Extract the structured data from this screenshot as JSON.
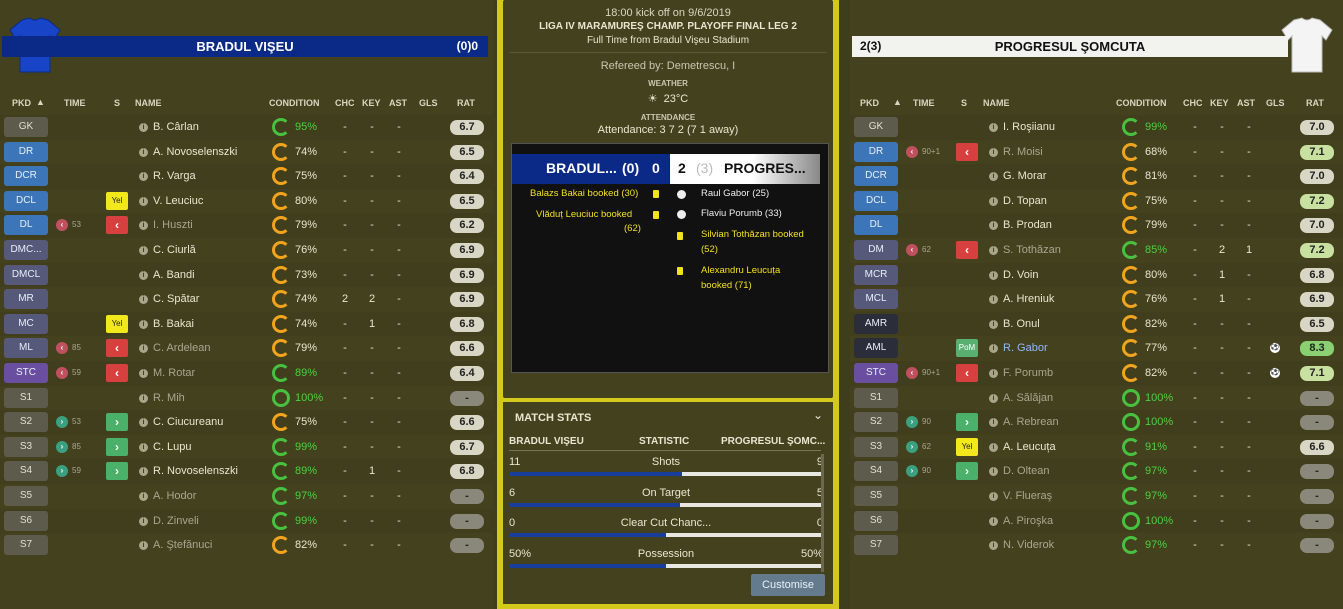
{
  "home": {
    "name": "BRADUL VIŞEU",
    "score": "(0)0",
    "short": "BRADUL...",
    "sb_pen": "(0)",
    "sb_score": "0"
  },
  "away": {
    "name": "PROGRESUL ŞOMCUTA",
    "score": "2(3)",
    "short": "PROGRES...",
    "sb_pen": "(3)",
    "sb_score": "2"
  },
  "headers": {
    "pkd": "PKD",
    "time": "TIME",
    "s": "S",
    "name": "NAME",
    "condition": "CONDITION",
    "chc": "CHC",
    "key": "KEY",
    "ast": "AST",
    "gls": "GLS",
    "rat": "RAT"
  },
  "match": {
    "kickoff": "18:00 kick off on 9/6/2019",
    "competition": "LIGA IV MARAMUREŞ CHAMP. PLAYOFF FINAL LEG 2",
    "result_line": "Full Time from Bradul Vişeu Stadium",
    "referee": "Refereed by: Demetrescu, I",
    "weather_label": "WEATHER",
    "temperature": "23°C",
    "attendance_label": "ATTENDANCE",
    "attendance": "Attendance: 3 7 2 (7 1 away)"
  },
  "events_home": [
    "Balazs Bakai booked (30)",
    "Vlăduț Leuciuc booked",
    "(62)"
  ],
  "events_away": [
    "Raul Gabor (25)",
    "Flaviu Porumb (33)",
    "Silvian Tothăzan booked",
    "(52)",
    "Alexandru Leucuța",
    "booked (71)"
  ],
  "stats": {
    "title": "MATCH STATS",
    "col_home": "BRADUL VIŞEU",
    "col_stat": "STATISTIC",
    "col_away": "PROGRESUL ŞOMC...",
    "rows": [
      {
        "label": "Shots",
        "home": "11",
        "away": "9",
        "home_share": 0.55
      },
      {
        "label": "On Target",
        "home": "6",
        "away": "5",
        "home_share": 0.545
      },
      {
        "label": "Clear Cut Chanc...",
        "home": "0",
        "away": "0",
        "home_share": 0.5
      },
      {
        "label": "Possession",
        "home": "50%",
        "away": "50%",
        "home_share": 0.5
      }
    ],
    "customise": "Customise"
  },
  "home_players": [
    {
      "pos": "GK",
      "name": "B. Cârlan",
      "cond": "95%",
      "chc": "-",
      "key": "-",
      "ast": "-",
      "rat": "6.7"
    },
    {
      "pos": "DR",
      "name": "A. Novoselenszki",
      "cond": "74%",
      "chc": "-",
      "key": "-",
      "ast": "-",
      "rat": "6.5"
    },
    {
      "pos": "DCR",
      "name": "R. Varga",
      "cond": "75%",
      "chc": "-",
      "key": "-",
      "ast": "-",
      "rat": "6.4"
    },
    {
      "pos": "DCL",
      "name": "V. Leuciuc",
      "cond": "80%",
      "chc": "-",
      "key": "-",
      "ast": "-",
      "rat": "6.5",
      "s": "Yel"
    },
    {
      "pos": "DL",
      "name": "I. Huszti",
      "cond": "79%",
      "chc": "-",
      "key": "-",
      "ast": "-",
      "rat": "6.2",
      "time": "53"
    },
    {
      "pos": "DMC...",
      "name": "C. Ciurlă",
      "cond": "76%",
      "chc": "-",
      "key": "-",
      "ast": "-",
      "rat": "6.9"
    },
    {
      "pos": "DMCL",
      "name": "A. Bandi",
      "cond": "73%",
      "chc": "-",
      "key": "-",
      "ast": "-",
      "rat": "6.9"
    },
    {
      "pos": "MR",
      "name": "C. Spătar",
      "cond": "74%",
      "chc": "2",
      "key": "2",
      "ast": "-",
      "rat": "6.9"
    },
    {
      "pos": "MC",
      "name": "B. Bakai",
      "cond": "74%",
      "chc": "-",
      "key": "1",
      "ast": "-",
      "rat": "6.8",
      "s": "Yel"
    },
    {
      "pos": "ML",
      "name": "C. Ardelean",
      "cond": "79%",
      "chc": "-",
      "key": "-",
      "ast": "-",
      "rat": "6.6",
      "time": "85"
    },
    {
      "pos": "STC",
      "name": "M. Rotar",
      "cond": "89%",
      "chc": "-",
      "key": "-",
      "ast": "-",
      "rat": "6.4",
      "time": "59"
    },
    {
      "pos": "S1",
      "name": "R. Mih",
      "cond": "100%",
      "chc": "-",
      "key": "-",
      "ast": "-",
      "rat": "-"
    },
    {
      "pos": "S2",
      "name": "C. Ciucureanu",
      "cond": "75%",
      "chc": "-",
      "key": "-",
      "ast": "-",
      "rat": "6.6",
      "time": "53"
    },
    {
      "pos": "S3",
      "name": "C. Lupu",
      "cond": "99%",
      "chc": "-",
      "key": "-",
      "ast": "-",
      "rat": "6.7",
      "time": "85"
    },
    {
      "pos": "S4",
      "name": "R. Novoselenszki",
      "cond": "89%",
      "chc": "-",
      "key": "1",
      "ast": "-",
      "rat": "6.8",
      "time": "59"
    },
    {
      "pos": "S5",
      "name": "A. Hodor",
      "cond": "97%",
      "chc": "-",
      "key": "-",
      "ast": "-",
      "rat": "-"
    },
    {
      "pos": "S6",
      "name": "D. Zinveli",
      "cond": "99%",
      "chc": "-",
      "key": "-",
      "ast": "-",
      "rat": "-"
    },
    {
      "pos": "S7",
      "name": "A. Ştefănuci",
      "cond": "82%",
      "chc": "-",
      "key": "-",
      "ast": "-",
      "rat": "-"
    }
  ],
  "away_players": [
    {
      "pos": "GK",
      "name": "I. Roşiianu",
      "cond": "99%",
      "chc": "-",
      "key": "-",
      "ast": "-",
      "rat": "7.0"
    },
    {
      "pos": "DR",
      "name": "R. Moisi",
      "cond": "68%",
      "chc": "-",
      "key": "-",
      "ast": "-",
      "rat": "7.1",
      "time": "90+1"
    },
    {
      "pos": "DCR",
      "name": "G. Morar",
      "cond": "81%",
      "chc": "-",
      "key": "-",
      "ast": "-",
      "rat": "7.0"
    },
    {
      "pos": "DCL",
      "name": "D. Topan",
      "cond": "75%",
      "chc": "-",
      "key": "-",
      "ast": "-",
      "rat": "7.2"
    },
    {
      "pos": "DL",
      "name": "B. Prodan",
      "cond": "79%",
      "chc": "-",
      "key": "-",
      "ast": "-",
      "rat": "7.0"
    },
    {
      "pos": "DM",
      "name": "S. Tothăzan",
      "cond": "85%",
      "chc": "-",
      "key": "2",
      "ast": "1",
      "rat": "7.2",
      "time": "62"
    },
    {
      "pos": "MCR",
      "name": "D. Voin",
      "cond": "80%",
      "chc": "-",
      "key": "1",
      "ast": "-",
      "rat": "6.8"
    },
    {
      "pos": "MCL",
      "name": "A. Hreniuk",
      "cond": "76%",
      "chc": "-",
      "key": "1",
      "ast": "-",
      "rat": "6.9"
    },
    {
      "pos": "AMR",
      "name": "B. Onul",
      "cond": "82%",
      "chc": "-",
      "key": "-",
      "ast": "-",
      "rat": "6.5"
    },
    {
      "pos": "AML",
      "name": "R. Gabor",
      "cond": "77%",
      "chc": "-",
      "key": "-",
      "ast": "-",
      "rat": "8.3",
      "s": "PoM"
    },
    {
      "pos": "STC",
      "name": "F. Porumb",
      "cond": "82%",
      "chc": "-",
      "key": "-",
      "ast": "-",
      "rat": "7.1",
      "time": "90+1"
    },
    {
      "pos": "S1",
      "name": "A. Sălăjan",
      "cond": "100%",
      "chc": "-",
      "key": "-",
      "ast": "-",
      "rat": "-"
    },
    {
      "pos": "S2",
      "name": "A. Rebrean",
      "cond": "100%",
      "chc": "-",
      "key": "-",
      "ast": "-",
      "rat": "-",
      "time": "90"
    },
    {
      "pos": "S3",
      "name": "A. Leucuța",
      "cond": "91%",
      "chc": "-",
      "key": "-",
      "ast": "-",
      "rat": "6.6",
      "time": "62",
      "s": "Yel"
    },
    {
      "pos": "S4",
      "name": "D. Oltean",
      "cond": "97%",
      "chc": "-",
      "key": "-",
      "ast": "-",
      "rat": "-",
      "time": "90"
    },
    {
      "pos": "S5",
      "name": "V. Flueraş",
      "cond": "97%",
      "chc": "-",
      "key": "-",
      "ast": "-",
      "rat": "-"
    },
    {
      "pos": "S6",
      "name": "A. Piroşka",
      "cond": "100%",
      "chc": "-",
      "key": "-",
      "ast": "-",
      "rat": "-"
    },
    {
      "pos": "S7",
      "name": "N. Viderok",
      "cond": "97%",
      "chc": "-",
      "key": "-",
      "ast": "-",
      "rat": "-"
    }
  ]
}
